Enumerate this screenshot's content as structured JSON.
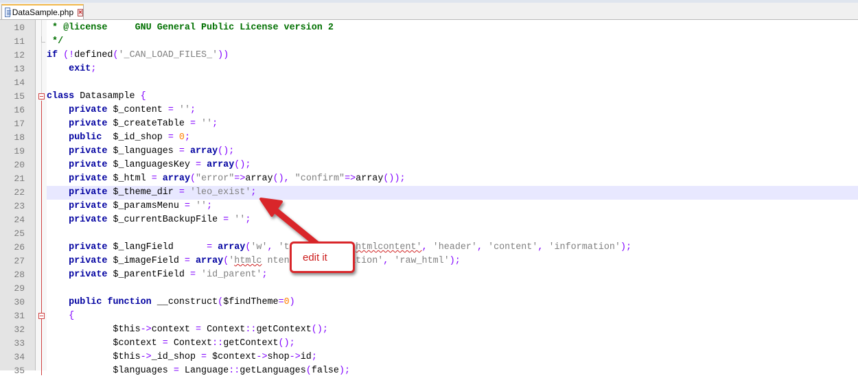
{
  "tab": {
    "filename": "DataSample.php",
    "close_glyph": "×",
    "icon": "php-file-icon"
  },
  "editor": {
    "active_line": 22,
    "lines": [
      {
        "n": "10",
        "code": " * @license     GNU General Public License version 2"
      },
      {
        "n": "11",
        "code": " */"
      },
      {
        "n": "12",
        "code": "if (!defined('_CAN_LOAD_FILES_'))"
      },
      {
        "n": "13",
        "code": "    exit;"
      },
      {
        "n": "14",
        "code": ""
      },
      {
        "n": "15",
        "code": "class Datasample {"
      },
      {
        "n": "16",
        "code": "    private $_content = '';"
      },
      {
        "n": "17",
        "code": "    private $_createTable = '';"
      },
      {
        "n": "18",
        "code": "    public  $_id_shop = 0;"
      },
      {
        "n": "19",
        "code": "    private $_languages = array();"
      },
      {
        "n": "20",
        "code": "    private $_languagesKey = array();"
      },
      {
        "n": "21",
        "code": "    private $_html = array(\"error\"=>array(), \"confirm\"=>array());"
      },
      {
        "n": "22",
        "code": "    private $_theme_dir = 'leo_exist';"
      },
      {
        "n": "23",
        "code": "    private $_paramsMenu = '';"
      },
      {
        "n": "24",
        "code": "    private $_currentBackupFile = '';"
      },
      {
        "n": "25",
        "code": ""
      },
      {
        "n": "26",
        "code": "    private $_langField      = array('w', 'text_link', 'htmlcontent', 'header', 'content', 'information');"
      },
      {
        "n": "27",
        "code": "    private $_imageField = array('htmlc ntent', 'information', 'raw_html');"
      },
      {
        "n": "28",
        "code": "    private $_parentField = 'id_parent';"
      },
      {
        "n": "29",
        "code": ""
      },
      {
        "n": "30",
        "code": "    public function __construct($findTheme=0)"
      },
      {
        "n": "31",
        "code": "    {"
      },
      {
        "n": "32",
        "code": "            $this->context = Context::getContext();"
      },
      {
        "n": "33",
        "code": "            $context = Context::getContext();"
      },
      {
        "n": "34",
        "code": "            $this->_id_shop = $context->shop->id;"
      },
      {
        "n": "35",
        "code": "            $languages = Language::getLanguages(false);"
      }
    ]
  },
  "annotation": {
    "label": "edit it",
    "color": "#d9262a"
  }
}
